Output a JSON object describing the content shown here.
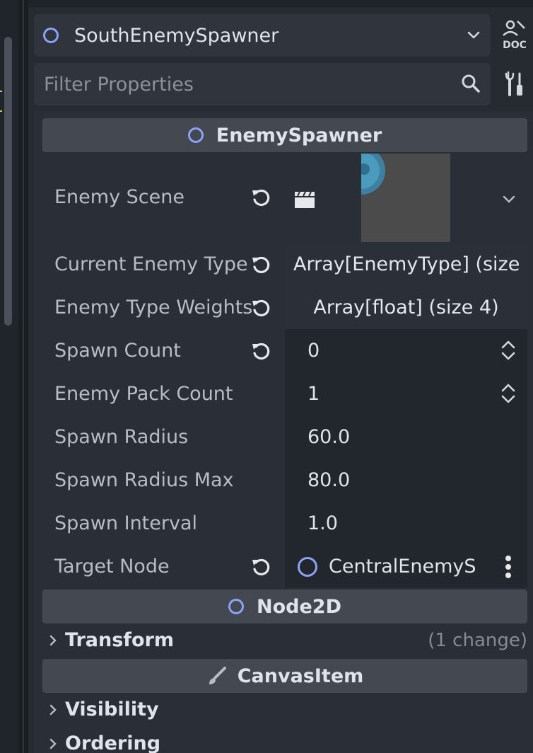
{
  "node_selector": {
    "name": "SouthEnemySpawner"
  },
  "filter": {
    "placeholder": "Filter Properties"
  },
  "sections": {
    "enemy_spawner": {
      "title": "EnemySpawner"
    },
    "node2d": {
      "title": "Node2D"
    },
    "canvas_item": {
      "title": "CanvasItem"
    }
  },
  "properties": [
    {
      "label": "Enemy Scene"
    },
    {
      "label": "Current Enemy Type",
      "value": "Array[EnemyType] (size"
    },
    {
      "label": "Enemy Type Weights",
      "value": "Array[float] (size 4)"
    },
    {
      "label": "Spawn Count",
      "value": "0"
    },
    {
      "label": "Enemy Pack Count",
      "value": "1"
    },
    {
      "label": "Spawn Radius",
      "value": "60.0"
    },
    {
      "label": "Spawn Radius Max",
      "value": "80.0"
    },
    {
      "label": "Spawn Interval",
      "value": "1.0"
    },
    {
      "label": "Target Node",
      "value": "CentralEnemyS"
    }
  ],
  "groups": {
    "transform": {
      "label": "Transform",
      "note": "(1 change)"
    },
    "visibility": {
      "label": "Visibility"
    },
    "ordering": {
      "label": "Ordering"
    }
  },
  "colors": {
    "node_ring": "#8da1f5",
    "panel_bg": "#2a2e36",
    "header_bg": "#434851",
    "value_bg": "#22262d"
  }
}
